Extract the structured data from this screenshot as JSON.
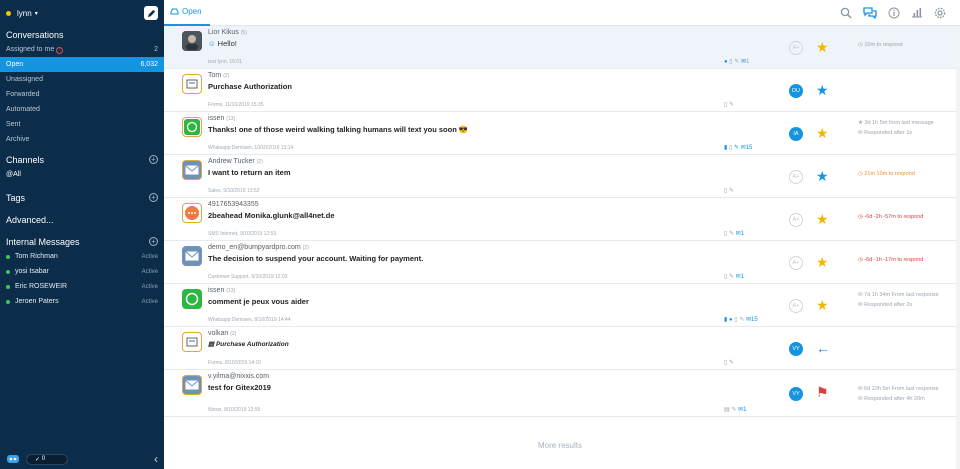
{
  "sidebar": {
    "user": "lynn",
    "sections": {
      "conversations": "Conversations",
      "channels": "Channels",
      "tags": "Tags",
      "advanced": "Advanced...",
      "internal": "Internal Messages"
    },
    "nav": [
      {
        "label": "Assigned to me",
        "count": "2"
      },
      {
        "label": "Open",
        "count": "6,032"
      },
      {
        "label": "Unassigned",
        "count": ""
      },
      {
        "label": "Forwarded",
        "count": ""
      },
      {
        "label": "Automated",
        "count": ""
      },
      {
        "label": "Sent",
        "count": ""
      },
      {
        "label": "Archive",
        "count": ""
      }
    ],
    "channel_all": "@All",
    "members": [
      {
        "name": "Tom Richman",
        "status": "Active"
      },
      {
        "name": "yosi tsabar",
        "status": "Active"
      },
      {
        "name": "Eric ROSEWEIR",
        "status": "Active"
      },
      {
        "name": "Jeroen Paters",
        "status": "Active"
      }
    ],
    "toggle_value": "0"
  },
  "topbar": {
    "tab": "Open"
  },
  "rows": [
    {
      "sender": "Lior Kikus",
      "count": "(5)",
      "subject": "Hello!",
      "meta": "test lynn, 16:01",
      "icons": "1",
      "assignee": "",
      "mark": "★",
      "info1": "10m to respond",
      "info2": ""
    },
    {
      "sender": "Tom",
      "count": "(2)",
      "subject": "Purchase Authorization",
      "meta": "Forms, 11/10/2019 15:35",
      "icons": "",
      "assignee": "DU",
      "mark": "★",
      "info1": "",
      "info2": ""
    },
    {
      "sender": "issen",
      "count": "(13)",
      "subject": "Thanks! one of those weird walking talking humans will text you soon 😎",
      "meta": "Whatsapp Demisen, 10/10/2019 13:14",
      "icons": "15",
      "assignee": "IA",
      "mark": "★",
      "info1": "3d 1h 5m from last message",
      "info2": "Responded after 1s"
    },
    {
      "sender": "Andrew Tucker",
      "count": "(2)",
      "subject": "I want to return an item",
      "meta": "Sales, 9/10/2019 13:52",
      "icons": "",
      "assignee": "",
      "mark": "★",
      "info1": "21m 10m to respond",
      "info2": ""
    },
    {
      "sender": "4917653943355",
      "count": "",
      "subject": "2beahead Monika.glunk@all4net.de",
      "meta": "SMS Internet, 9/10/2019 12:53",
      "icons": "1",
      "assignee": "",
      "mark": "★",
      "info1": "-6d -2h -57m to respond",
      "info2": ""
    },
    {
      "sender": "demo_en@bumpyardpro.com",
      "count": "(2)",
      "subject": "The decision to suspend your account. Waiting for payment.",
      "meta": "Customer Support, 9/10/2019 12:03",
      "icons": "1",
      "assignee": "",
      "mark": "★",
      "info1": "-6d -1h -17m to respond",
      "info2": ""
    },
    {
      "sender": "issen",
      "count": "(13)",
      "subject": "comment je peux vous aider",
      "meta": "Whatsapp Demisen, 8/10/2019 14:44",
      "icons": "15",
      "assignee": "",
      "mark": "★",
      "info1": "7d 1h 34m From last response",
      "info2": "Responded after 2s"
    },
    {
      "sender": "volkan",
      "count": "(2)",
      "subject": "Purchase Authorization",
      "meta": "Forms, 8/10/2019 14:10",
      "icons": "",
      "assignee": "VY",
      "mark": "←",
      "info1": "",
      "info2": ""
    },
    {
      "sender": "v.yilma@nixxis.com",
      "count": "",
      "subject": "test for Gitex2019",
      "meta": "Nixxis, 8/10/2019 13:55",
      "icons": "1",
      "assignee": "VY",
      "mark": "⚑",
      "info1": "6d 22h 5m From last response",
      "info2": "Responded after 4h 20m"
    }
  ],
  "more_results": "More results",
  "colors": {
    "sidebar": "#0b2d4a",
    "accent": "#1594e0",
    "star": "#f2b705",
    "alert": "#e03a3a",
    "warn": "#e8912b"
  }
}
